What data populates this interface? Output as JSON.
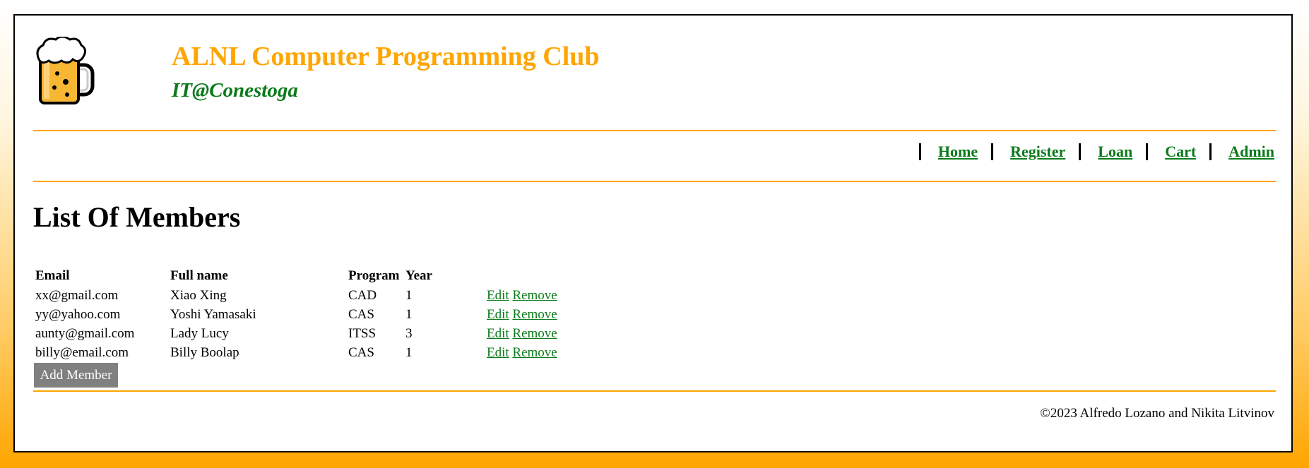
{
  "header": {
    "title": "ALNL Computer Programming Club",
    "subtitle": "IT@Conestoga",
    "logo_icon": "beer-mug-icon"
  },
  "nav": {
    "items": [
      {
        "label": "Home"
      },
      {
        "label": "Register"
      },
      {
        "label": "Loan"
      },
      {
        "label": "Cart"
      },
      {
        "label": "Admin"
      }
    ]
  },
  "main": {
    "title": "List Of Members",
    "table": {
      "headers": [
        "Email",
        "Full name",
        "Program",
        "Year"
      ],
      "rows": [
        {
          "email": "xx@gmail.com",
          "name": "Xiao Xing",
          "program": "CAD",
          "year": "1",
          "edit": "Edit",
          "remove": "Remove"
        },
        {
          "email": "yy@yahoo.com",
          "name": "Yoshi Yamasaki",
          "program": "CAS",
          "year": "1",
          "edit": "Edit",
          "remove": "Remove"
        },
        {
          "email": "aunty@gmail.com",
          "name": "Lady Lucy",
          "program": "ITSS",
          "year": "3",
          "edit": "Edit",
          "remove": "Remove"
        },
        {
          "email": "billy@email.com",
          "name": "Billy Boolap",
          "program": "CAS",
          "year": "1",
          "edit": "Edit",
          "remove": "Remove"
        }
      ]
    },
    "add_button": "Add Member"
  },
  "footer": {
    "text": "©2023 Alfredo Lozano and Nikita Litvinov"
  },
  "colors": {
    "brand_orange": "#ffa500",
    "link_green": "#0a7a1a",
    "button_gray": "#808080"
  }
}
